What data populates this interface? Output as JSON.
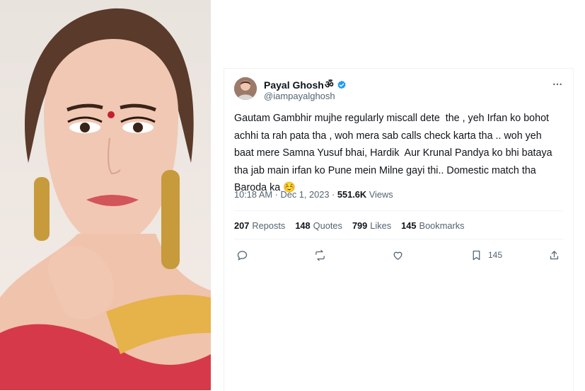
{
  "tweet": {
    "display_name": "Payal Ghosh",
    "name_suffix": "ॐ",
    "handle": "@iampayalghosh",
    "text": "Gautam Gambhir mujhe regularly miscall dete  the , yeh Irfan ko bohot\nachhi ta rah pata tha , woh mera sab calls check karta tha .. woh yeh\nbaat mere Samna Yusuf bhai, Hardik  Aur Krunal Pandya ko bhi bataya\ntha jab main irfan ko Pune mein Milne gayi thi.. Domestic match tha\nBaroda ka ☺️",
    "time": "10:18 AM",
    "separator": "·",
    "date": "Dec 1, 2023",
    "separator2": "·",
    "views_count": "551.6K",
    "views_label": "Views"
  },
  "stats": {
    "reposts_count": "207",
    "reposts_label": "Reposts",
    "quotes_count": "148",
    "quotes_label": "Quotes",
    "likes_count": "799",
    "likes_label": "Likes",
    "bookmarks_count": "145",
    "bookmarks_label": "Bookmarks"
  },
  "actions": {
    "bookmark_count": "145"
  },
  "colors": {
    "verified": "#1d9bf0",
    "text": "#0f1419",
    "muted": "#536471",
    "border": "#eff3f4"
  },
  "icons": [
    "verified-badge-icon",
    "more-icon",
    "reply-icon",
    "repost-icon",
    "like-icon",
    "bookmark-icon",
    "share-icon"
  ]
}
